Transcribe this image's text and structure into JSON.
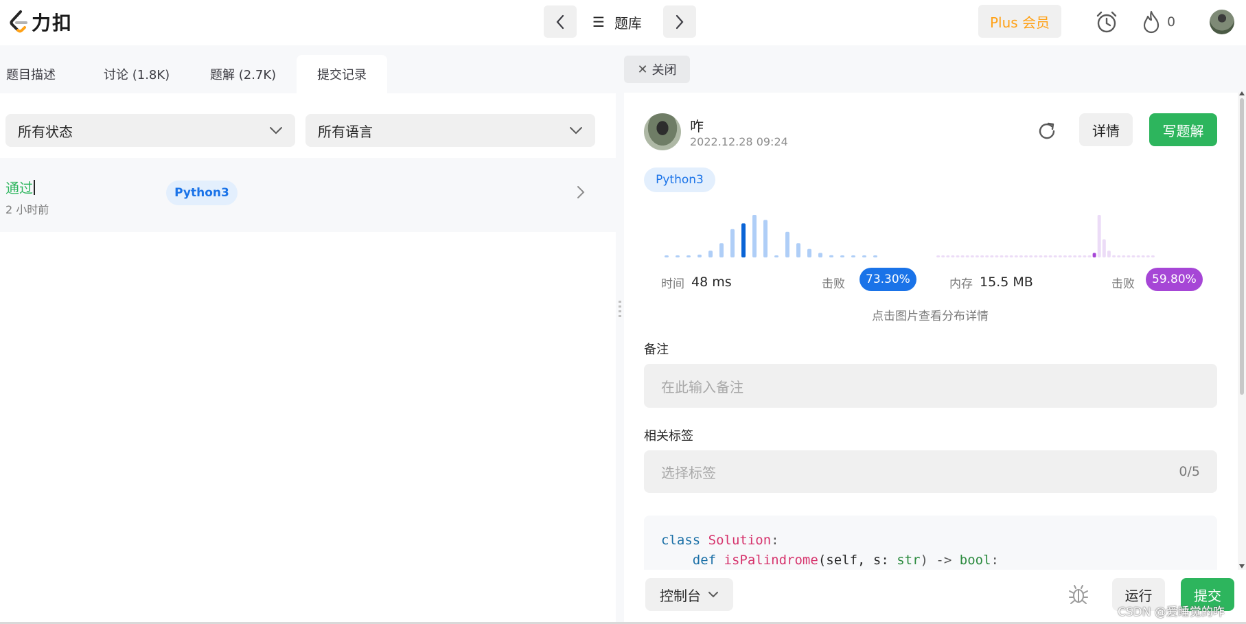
{
  "brand": {
    "logo_text": "力扣"
  },
  "nav": {
    "bank_label": "题库",
    "plus_label": "Plus 会员",
    "streak_count": "0",
    "icons": [
      "chevron-left-icon",
      "menu-icon",
      "chevron-right-icon",
      "alarm-icon",
      "flame-icon"
    ]
  },
  "left": {
    "tabs": [
      {
        "label": "题目描述",
        "active": false
      },
      {
        "label": "讨论 (1.8K)",
        "active": false
      },
      {
        "label": "题解 (2.7K)",
        "active": false
      },
      {
        "label": "提交记录",
        "active": true
      }
    ],
    "filter_status": "所有状态",
    "filter_language": "所有语言",
    "submission": {
      "status": "通过",
      "time_ago": "2 小时前",
      "language": "Python3",
      "status_color": "#2db55d"
    }
  },
  "right": {
    "close_label": "关闭",
    "author": {
      "name": "咋",
      "date": "2022.12.28 09:24"
    },
    "details_label": "详情",
    "write_solution_label": "写题解",
    "language_badge": "Python3",
    "runtime": {
      "label": "时间",
      "value": "48 ms",
      "beat_label": "击败",
      "beat_value": "73.30%",
      "color": "#1a73e8"
    },
    "memory": {
      "label": "内存",
      "value": "15.5 MB",
      "beat_label": "击败",
      "beat_value": "59.80%",
      "color": "#a646d6"
    },
    "chart_hint": "点击图片查看分布详情",
    "note_label": "备注",
    "note_placeholder": "在此输入备注",
    "tags_label": "相关标签",
    "tags_placeholder": "选择标签",
    "tags_count": "0/5",
    "code": {
      "line1_kw": "class",
      "line1_name": "Solution",
      "line1_tail": ":",
      "line2_kw": "def",
      "line2_fn": "isPalindrome",
      "line2_args": "(self, s: ",
      "line2_type": "str",
      "line2_mid": ") -> ",
      "line2_ret": "bool",
      "line2_tail": ":"
    }
  },
  "bottom": {
    "console_label": "控制台",
    "run_label": "运行",
    "submit_label": "提交",
    "watermark": "CSDN @爱睡觉的咋"
  },
  "chart_data": [
    {
      "type": "bar",
      "series": [
        {
          "values": [
            0.02,
            0.02,
            0.02,
            0.05,
            0.12,
            0.25,
            0.5,
            0.6,
            0.75,
            0.66,
            0.02,
            0.45,
            0.25,
            0.15,
            0.08,
            0.04,
            0.02,
            0.02,
            0.02,
            0.02
          ],
          "highlight_index": 7
        }
      ],
      "color": "#1a73e8",
      "highlight_color": "#0a64d6"
    },
    {
      "type": "bar",
      "series": [
        {
          "values": [
            0.02,
            0.02,
            0.02,
            0.02,
            0.02,
            0.02,
            0.02,
            0.02,
            0.02,
            0.02,
            0.02,
            0.02,
            0.02,
            0.02,
            0.02,
            0.02,
            0.02,
            0.02,
            0.02,
            0.02,
            0.02,
            0.02,
            0.02,
            0.02,
            0.02,
            0.02,
            0.02,
            0.02,
            0.02,
            0.02,
            0.02,
            0.03,
            0.08,
            0.75,
            0.32,
            0.12,
            0.04,
            0.02,
            0.02,
            0.02,
            0.02,
            0.02,
            0.02,
            0.02,
            0.02
          ],
          "highlight_index": 32
        }
      ],
      "color": "#c99ae8",
      "highlight_color": "#a646d6"
    }
  ]
}
